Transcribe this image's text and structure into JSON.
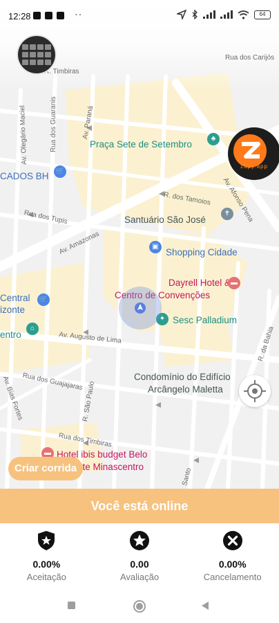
{
  "status_bar": {
    "time": "12:28",
    "more": "··",
    "battery": "64"
  },
  "map": {
    "places": {
      "praca": "Praça Sete de Setembro",
      "santuario": "Santuário São José",
      "shopping": "Shopping Cidade",
      "dayrell_1": "Dayrell Hotel &",
      "dayrell_2": "Centro de Convenções",
      "sesc": "Sesc Palladium",
      "condominio_1": "Condomínio do Edifício",
      "condominio_2": "Arcângelo Maletta",
      "ibis_1": "Hotel ibis budget Belo",
      "ibis_2": "nte Minascentro",
      "mercados": "CADOS BH",
      "central_1": "Central",
      "central_2": "izonte",
      "centro": "entro"
    },
    "streets": {
      "carijos": "Rua dos Carijós",
      "guaranis": "Rua dos Guaranis",
      "parana": "Av. Paraná",
      "olegario": "Av. Olegário Maciel",
      "timbiras_top": "R. Timbiras",
      "tamoios": "R. dos Tamoios",
      "afonso_pena": "Av. Afonso Pena",
      "tupis": "Rua dos Tupis",
      "amazonas": "Av. Amazonas",
      "augusto": "Av. Augusto de Lima",
      "guajajaras": "Rua dos Guajajaras",
      "bias_fortes": "Av. Bias Fortes",
      "sao_paulo": "R. São Paulo",
      "timbiras": "Rua dos Timbiras",
      "bahia": "R. da Bahia",
      "santo": "Santo"
    }
  },
  "brand": {
    "logo_text": "zapy.app"
  },
  "actions": {
    "create_ride": "Criar corrida"
  },
  "banner": {
    "online": "Você está online"
  },
  "stats": [
    {
      "icon": "shield-star-icon",
      "value": "0.00%",
      "label": "Aceitação"
    },
    {
      "icon": "star-circle-icon",
      "value": "0.00",
      "label": "Avaliação"
    },
    {
      "icon": "close-circle-icon",
      "value": "0.00%",
      "label": "Cancelamento"
    }
  ],
  "colors": {
    "accent": "#f6c27e",
    "map_blocks": "#fbf1d0",
    "map_roads": "#ffffff"
  }
}
